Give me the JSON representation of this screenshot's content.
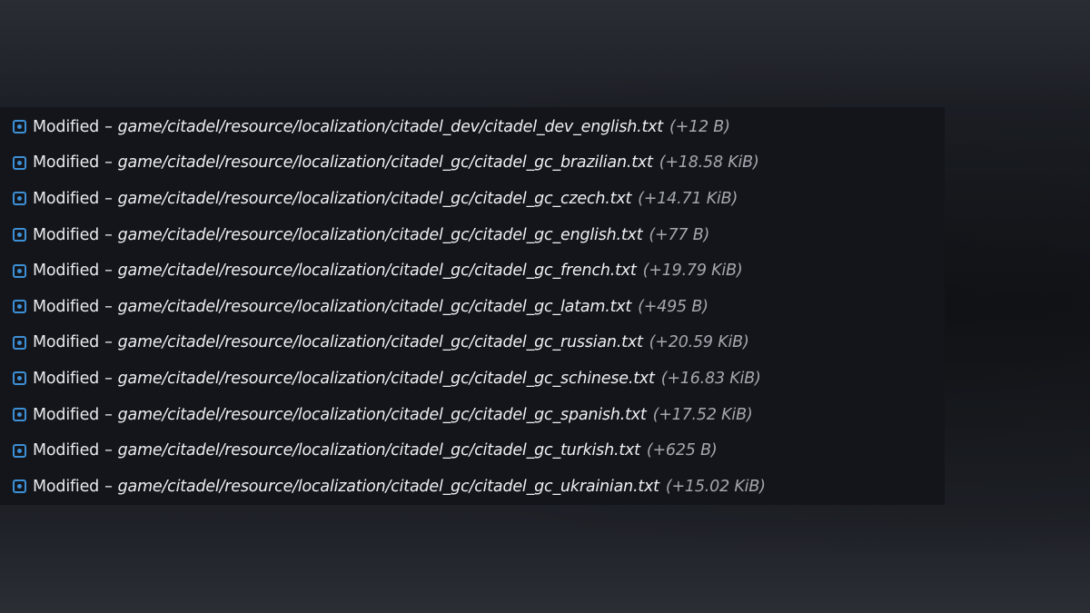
{
  "colors": {
    "icon": "#3d8fd6",
    "panel": "#13151a",
    "text": "#e9ebee",
    "size_text": "#a4a8ae"
  },
  "separator": "–",
  "changes": [
    {
      "status": "Modified",
      "path": "game/citadel/resource/localization/citadel_dev/citadel_dev_english.txt",
      "size": "(+12 B)",
      "icon": "modified-file-icon"
    },
    {
      "status": "Modified",
      "path": "game/citadel/resource/localization/citadel_gc/citadel_gc_brazilian.txt",
      "size": "(+18.58 KiB)",
      "icon": "modified-file-icon"
    },
    {
      "status": "Modified",
      "path": "game/citadel/resource/localization/citadel_gc/citadel_gc_czech.txt",
      "size": "(+14.71 KiB)",
      "icon": "modified-file-icon"
    },
    {
      "status": "Modified",
      "path": "game/citadel/resource/localization/citadel_gc/citadel_gc_english.txt",
      "size": "(+77 B)",
      "icon": "modified-file-icon"
    },
    {
      "status": "Modified",
      "path": "game/citadel/resource/localization/citadel_gc/citadel_gc_french.txt",
      "size": "(+19.79 KiB)",
      "icon": "modified-file-icon"
    },
    {
      "status": "Modified",
      "path": "game/citadel/resource/localization/citadel_gc/citadel_gc_latam.txt",
      "size": "(+495 B)",
      "icon": "modified-file-icon"
    },
    {
      "status": "Modified",
      "path": "game/citadel/resource/localization/citadel_gc/citadel_gc_russian.txt",
      "size": "(+20.59 KiB)",
      "icon": "modified-file-icon"
    },
    {
      "status": "Modified",
      "path": "game/citadel/resource/localization/citadel_gc/citadel_gc_schinese.txt",
      "size": "(+16.83 KiB)",
      "icon": "modified-file-icon"
    },
    {
      "status": "Modified",
      "path": "game/citadel/resource/localization/citadel_gc/citadel_gc_spanish.txt",
      "size": "(+17.52 KiB)",
      "icon": "modified-file-icon"
    },
    {
      "status": "Modified",
      "path": "game/citadel/resource/localization/citadel_gc/citadel_gc_turkish.txt",
      "size": "(+625 B)",
      "icon": "modified-file-icon"
    },
    {
      "status": "Modified",
      "path": "game/citadel/resource/localization/citadel_gc/citadel_gc_ukrainian.txt",
      "size": "(+15.02 KiB)",
      "icon": "modified-file-icon"
    }
  ]
}
